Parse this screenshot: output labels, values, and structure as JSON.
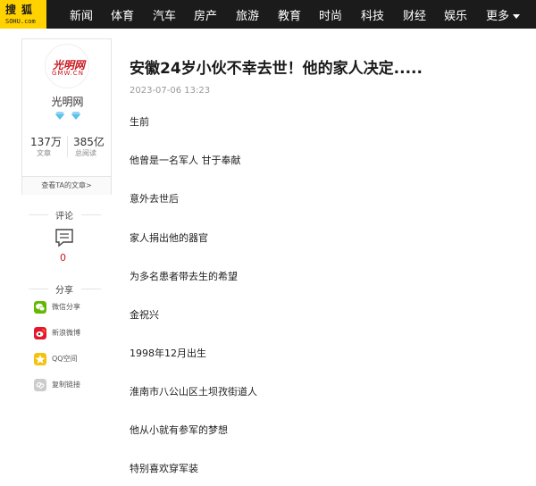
{
  "nav": {
    "logo_main": "搜狐",
    "logo_sub": "SOHU.com",
    "items": [
      "新闻",
      "体育",
      "汽车",
      "房产",
      "旅游",
      "教育",
      "时尚",
      "科技",
      "财经",
      "娱乐"
    ],
    "more": "更多"
  },
  "author": {
    "avatar_text_top": "光明网",
    "avatar_text_bottom": "GMW.CN",
    "name": "光明网",
    "articles_count": "137万",
    "articles_label": "文章",
    "reads_count": "385亿",
    "reads_label": "总阅读",
    "view_more": "查看TA的文章>"
  },
  "comment": {
    "title": "评论",
    "count": "0"
  },
  "share": {
    "title": "分享",
    "items": [
      {
        "label": "微信分享",
        "icon": "wechat-icon",
        "color": "#62b900"
      },
      {
        "label": "新浪微博",
        "icon": "weibo-icon",
        "color": "#e6162d"
      },
      {
        "label": "QQ空间",
        "icon": "qzone-icon",
        "color": "#f4c20d"
      },
      {
        "label": "复制链接",
        "icon": "link-icon",
        "color": "#cccccc"
      }
    ]
  },
  "article": {
    "title": "安徽24岁小伙不幸去世！他的家人决定.....",
    "date": "2023-07-06 13:23",
    "paragraphs": [
      "生前",
      "他曾是一名军人 甘于奉献",
      "意外去世后",
      "家人捐出他的器官",
      "为多名患者带去生的希望",
      "金祝兴",
      "1998年12月出生",
      "淮南市八公山区土坝孜街道人",
      "他从小就有参军的梦想",
      "特别喜欢穿军装"
    ]
  },
  "colors": {
    "nav_bg": "#1b1b1b",
    "logo_bg": "#ffd200",
    "accent_red": "#c8161d",
    "gem_blue": "#5bc0eb"
  }
}
